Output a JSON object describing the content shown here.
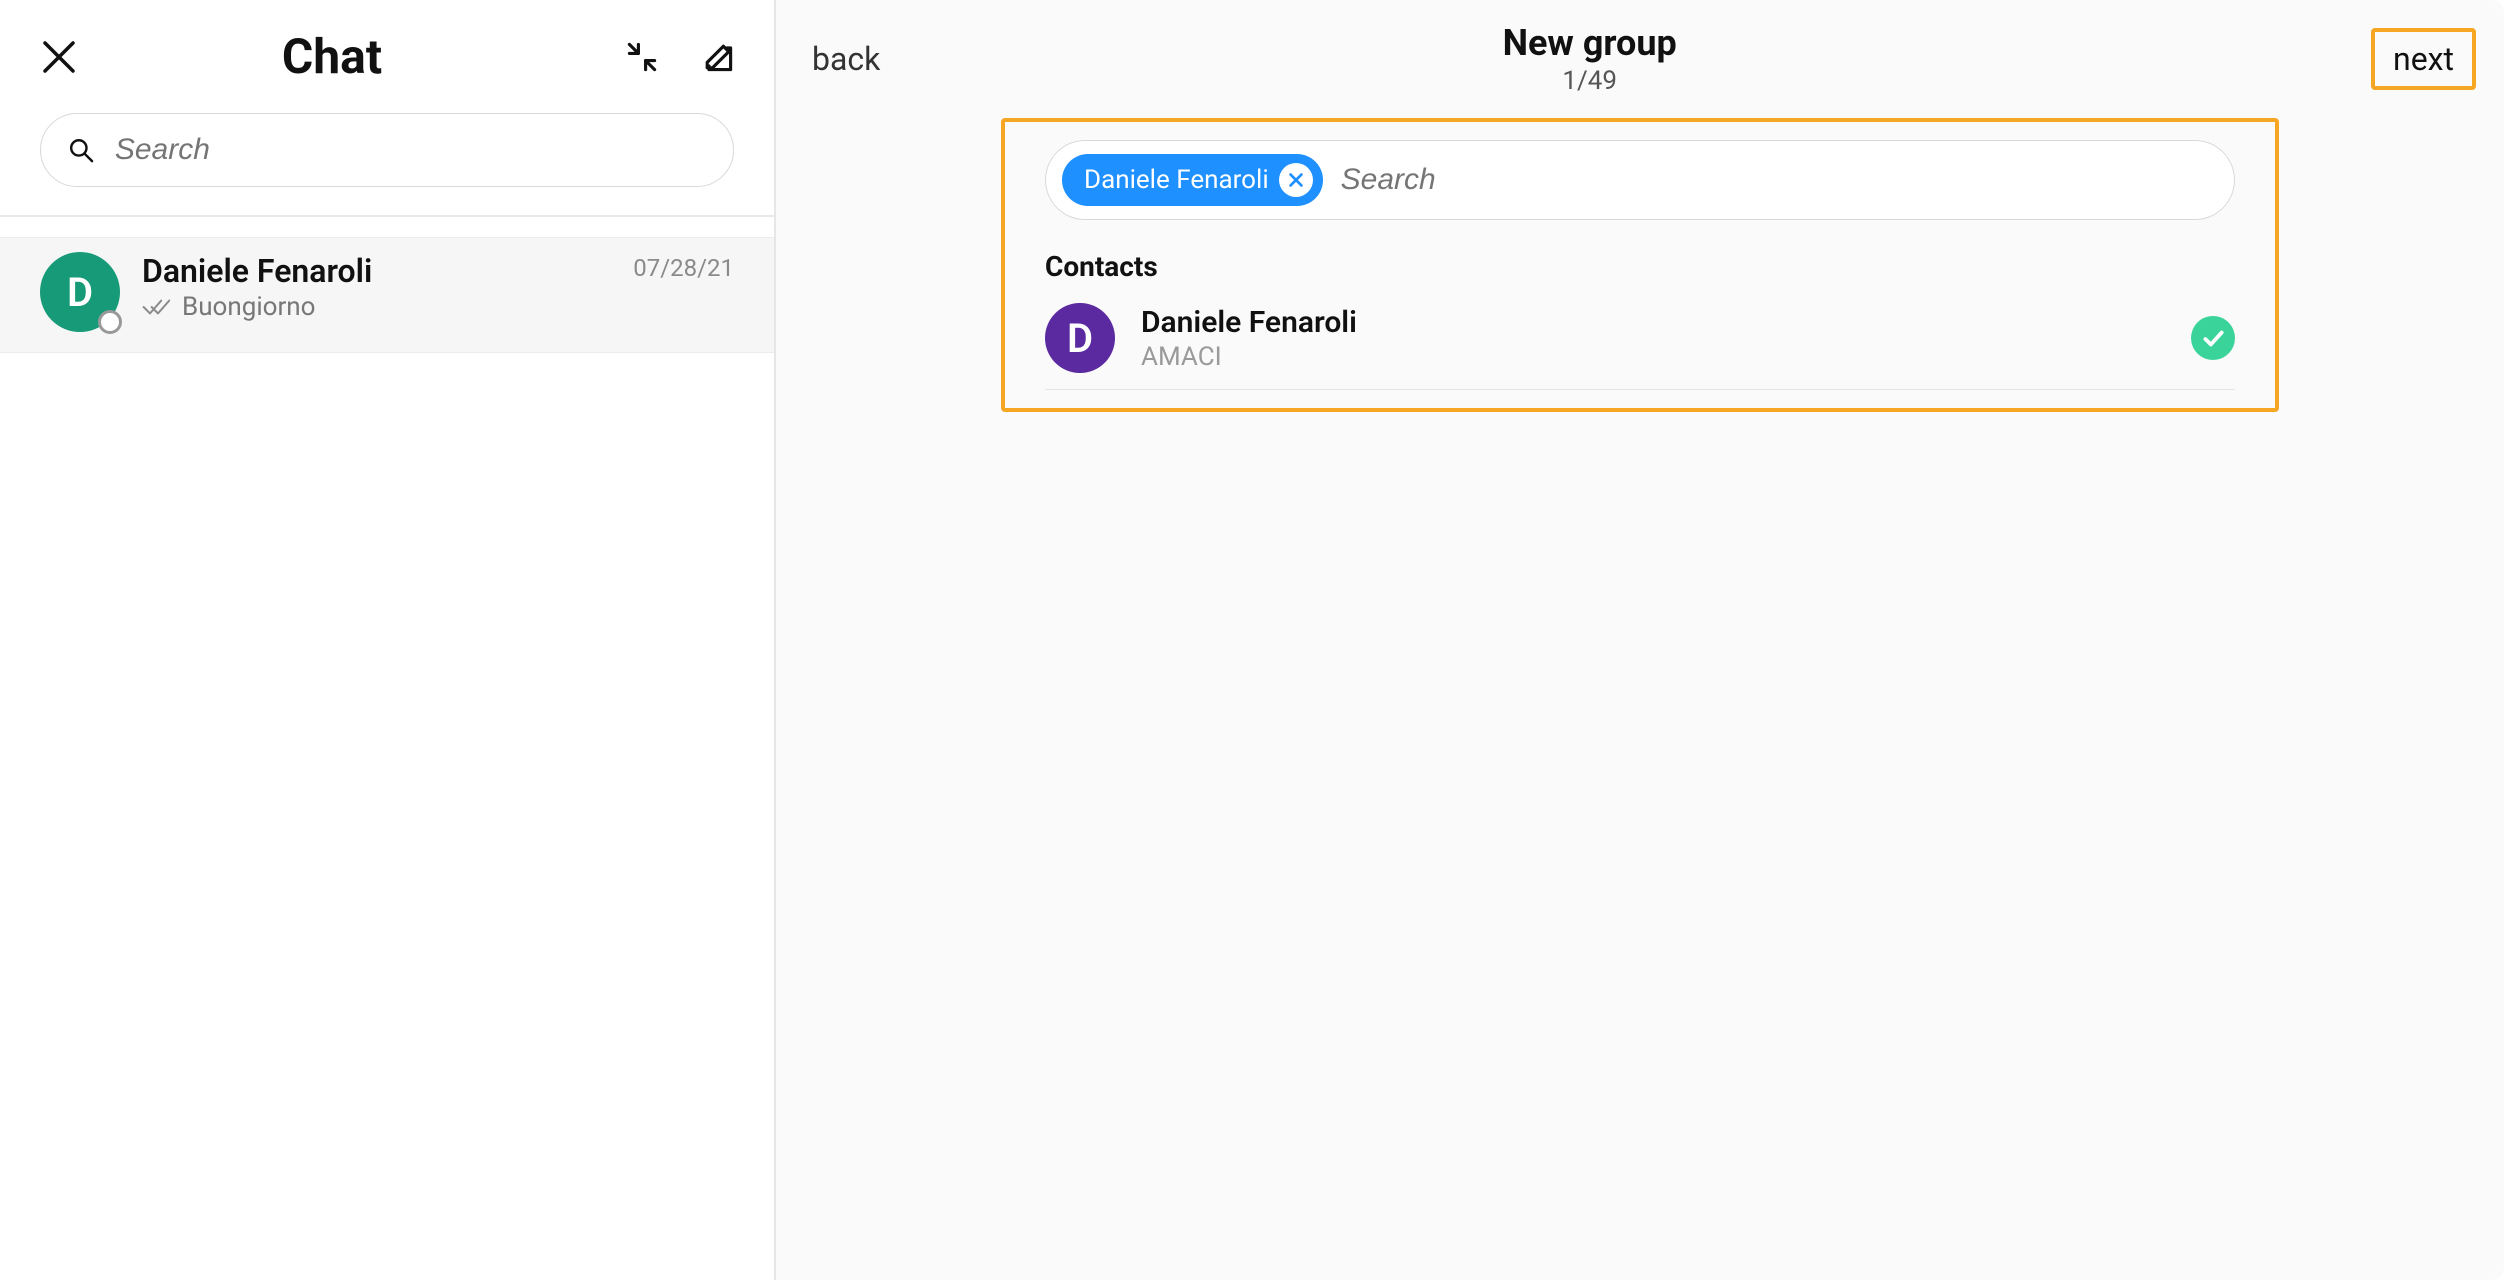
{
  "sidebar": {
    "title": "Chat",
    "search_placeholder": "Search",
    "chats": [
      {
        "initial": "D",
        "name": "Daniele Fenaroli",
        "preview": "Buongiorno",
        "date": "07/28/21",
        "avatar_color": "green"
      }
    ]
  },
  "main": {
    "back_label": "back",
    "title": "New group",
    "count": "1/49",
    "next_label": "next",
    "search_placeholder": "Search",
    "chips": [
      {
        "label": "Daniele Fenaroli"
      }
    ],
    "contacts_heading": "Contacts",
    "contacts": [
      {
        "initial": "D",
        "name": "Daniele Fenaroli",
        "subtitle": "AMACI",
        "avatar_color": "purple",
        "selected": true
      }
    ]
  },
  "colors": {
    "highlight": "#f5a623",
    "chip_bg": "#1e90ff",
    "check_bg": "#3ad49a"
  }
}
